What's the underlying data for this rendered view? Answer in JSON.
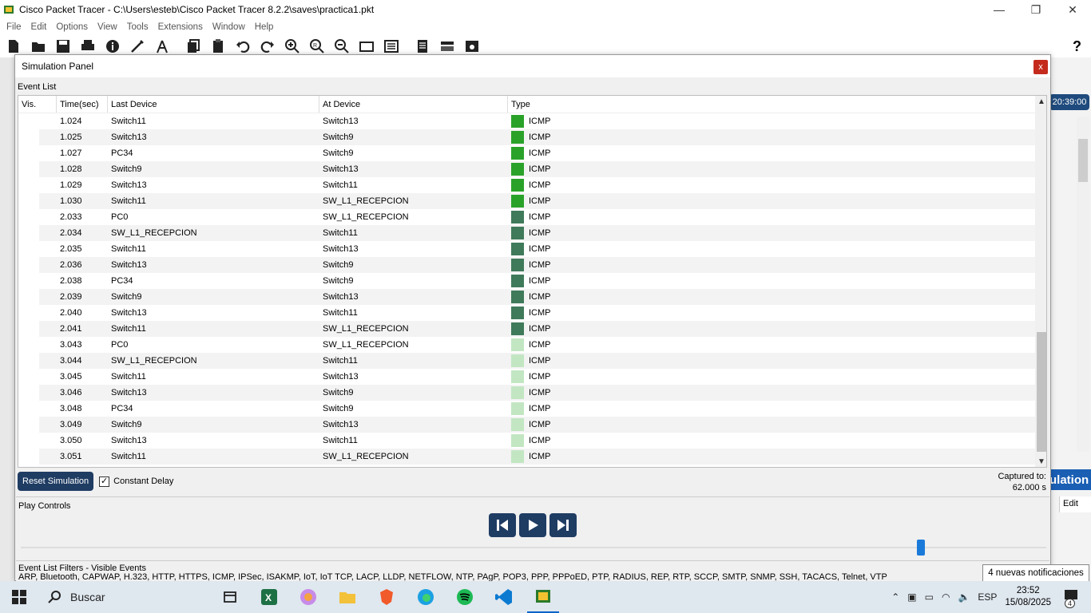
{
  "window": {
    "title": "Cisco Packet Tracer - C:\\Users\\esteb\\Cisco Packet Tracer 8.2.2\\saves\\practica1.pkt",
    "min_label": "—",
    "max_label": "❐",
    "close_label": "✕"
  },
  "menu": [
    "File",
    "Edit",
    "Options",
    "View",
    "Tools",
    "Extensions",
    "Window",
    "Help"
  ],
  "toolbar_icons": [
    "new-icon",
    "open-icon",
    "save-icon",
    "print-icon",
    "info-icon",
    "network-wizard-icon",
    "antenna-icon",
    "copy-icon",
    "paste-icon",
    "undo-icon",
    "redo-icon",
    "zoom-in-icon",
    "zoom-reset-icon",
    "zoom-out-icon",
    "palette-icon",
    "custom-device-icon",
    "notes-icon",
    "cluster-icon",
    "screenshot-icon"
  ],
  "help_label": "?",
  "side": {
    "time": "20:39:00",
    "simulation": "ulation",
    "edit_tab": "Edit"
  },
  "panel": {
    "title": "Simulation Panel",
    "close_label": "x",
    "event_list_label": "Event List",
    "columns": {
      "vis": "Vis.",
      "time": "Time(sec)",
      "last": "Last Device",
      "at": "At Device",
      "type": "Type"
    },
    "events": [
      {
        "time": "1.024",
        "last": "Switch11",
        "at": "Switch13",
        "type": "ICMP",
        "color": "#2aa22a"
      },
      {
        "time": "1.025",
        "last": "Switch13",
        "at": "Switch9",
        "type": "ICMP",
        "color": "#2aa22a"
      },
      {
        "time": "1.027",
        "last": "PC34",
        "at": "Switch9",
        "type": "ICMP",
        "color": "#2aa22a"
      },
      {
        "time": "1.028",
        "last": "Switch9",
        "at": "Switch13",
        "type": "ICMP",
        "color": "#2aa22a"
      },
      {
        "time": "1.029",
        "last": "Switch13",
        "at": "Switch11",
        "type": "ICMP",
        "color": "#2aa22a"
      },
      {
        "time": "1.030",
        "last": "Switch11",
        "at": "SW_L1_RECEPCION",
        "type": "ICMP",
        "color": "#2aa22a"
      },
      {
        "time": "2.033",
        "last": "PC0",
        "at": "SW_L1_RECEPCION",
        "type": "ICMP",
        "color": "#3f7a5a"
      },
      {
        "time": "2.034",
        "last": "SW_L1_RECEPCION",
        "at": "Switch11",
        "type": "ICMP",
        "color": "#3f7a5a"
      },
      {
        "time": "2.035",
        "last": "Switch11",
        "at": "Switch13",
        "type": "ICMP",
        "color": "#3f7a5a"
      },
      {
        "time": "2.036",
        "last": "Switch13",
        "at": "Switch9",
        "type": "ICMP",
        "color": "#3f7a5a"
      },
      {
        "time": "2.038",
        "last": "PC34",
        "at": "Switch9",
        "type": "ICMP",
        "color": "#3f7a5a"
      },
      {
        "time": "2.039",
        "last": "Switch9",
        "at": "Switch13",
        "type": "ICMP",
        "color": "#3f7a5a"
      },
      {
        "time": "2.040",
        "last": "Switch13",
        "at": "Switch11",
        "type": "ICMP",
        "color": "#3f7a5a"
      },
      {
        "time": "2.041",
        "last": "Switch11",
        "at": "SW_L1_RECEPCION",
        "type": "ICMP",
        "color": "#3f7a5a"
      },
      {
        "time": "3.043",
        "last": "PC0",
        "at": "SW_L1_RECEPCION",
        "type": "ICMP",
        "color": "#c2e6c2"
      },
      {
        "time": "3.044",
        "last": "SW_L1_RECEPCION",
        "at": "Switch11",
        "type": "ICMP",
        "color": "#c2e6c2"
      },
      {
        "time": "3.045",
        "last": "Switch11",
        "at": "Switch13",
        "type": "ICMP",
        "color": "#c2e6c2"
      },
      {
        "time": "3.046",
        "last": "Switch13",
        "at": "Switch9",
        "type": "ICMP",
        "color": "#c2e6c2"
      },
      {
        "time": "3.048",
        "last": "PC34",
        "at": "Switch9",
        "type": "ICMP",
        "color": "#c2e6c2"
      },
      {
        "time": "3.049",
        "last": "Switch9",
        "at": "Switch13",
        "type": "ICMP",
        "color": "#c2e6c2"
      },
      {
        "time": "3.050",
        "last": "Switch13",
        "at": "Switch11",
        "type": "ICMP",
        "color": "#c2e6c2"
      },
      {
        "time": "3.051",
        "last": "Switch11",
        "at": "SW_L1_RECEPCION",
        "type": "ICMP",
        "color": "#c2e6c2"
      }
    ],
    "reset_label": "Reset Simulation",
    "constant_delay_label": "Constant Delay",
    "constant_delay_checked": true,
    "captured_label": "Captured to:",
    "captured_value": "62.000 s",
    "play_controls_label": "Play Controls",
    "filters_label": "Event List Filters - Visible Events",
    "filters_protocols": "ARP, Bluetooth, CAPWAP, H.323, HTTP, HTTPS, ICMP, IPSec, ISAKMP, IoT, IoT TCP, LACP, LLDP, NETFLOW, NTP, PAgP, POP3, PPP, PPPoED, PTP, RADIUS, REP, RTP, SCCP, SMTP, SNMP, SSH, TACACS, Telnet, VTP"
  },
  "notification": "4 nuevas notificaciones",
  "taskbar": {
    "search_label": "Buscar",
    "lang": "ESP",
    "time": "23:52",
    "date": "15/08/2025",
    "notif_count": "4"
  }
}
